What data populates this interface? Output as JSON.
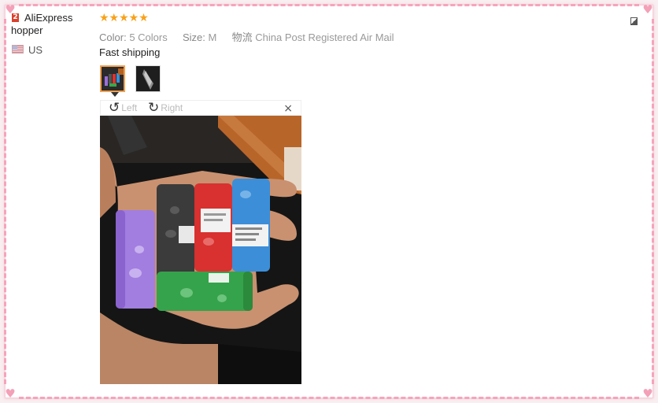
{
  "reviewer": {
    "country_badge": "2",
    "name": "AliExpress hopper",
    "country_code": "US"
  },
  "review": {
    "stars": "★★★★★",
    "rating": 5,
    "color_label": "Color:",
    "color_value": "5 Colors",
    "size_label": "Size:",
    "size_value": "M",
    "ship_label": "物流",
    "ship_value": "China Post Registered Air Mail",
    "text": "Fast shipping"
  },
  "viewer": {
    "rotate_left_label": "Left",
    "rotate_right_label": "Right",
    "close_glyph": "×"
  },
  "colors": {
    "accent_border": "#f5a4bb",
    "star": "#f7a21b"
  }
}
